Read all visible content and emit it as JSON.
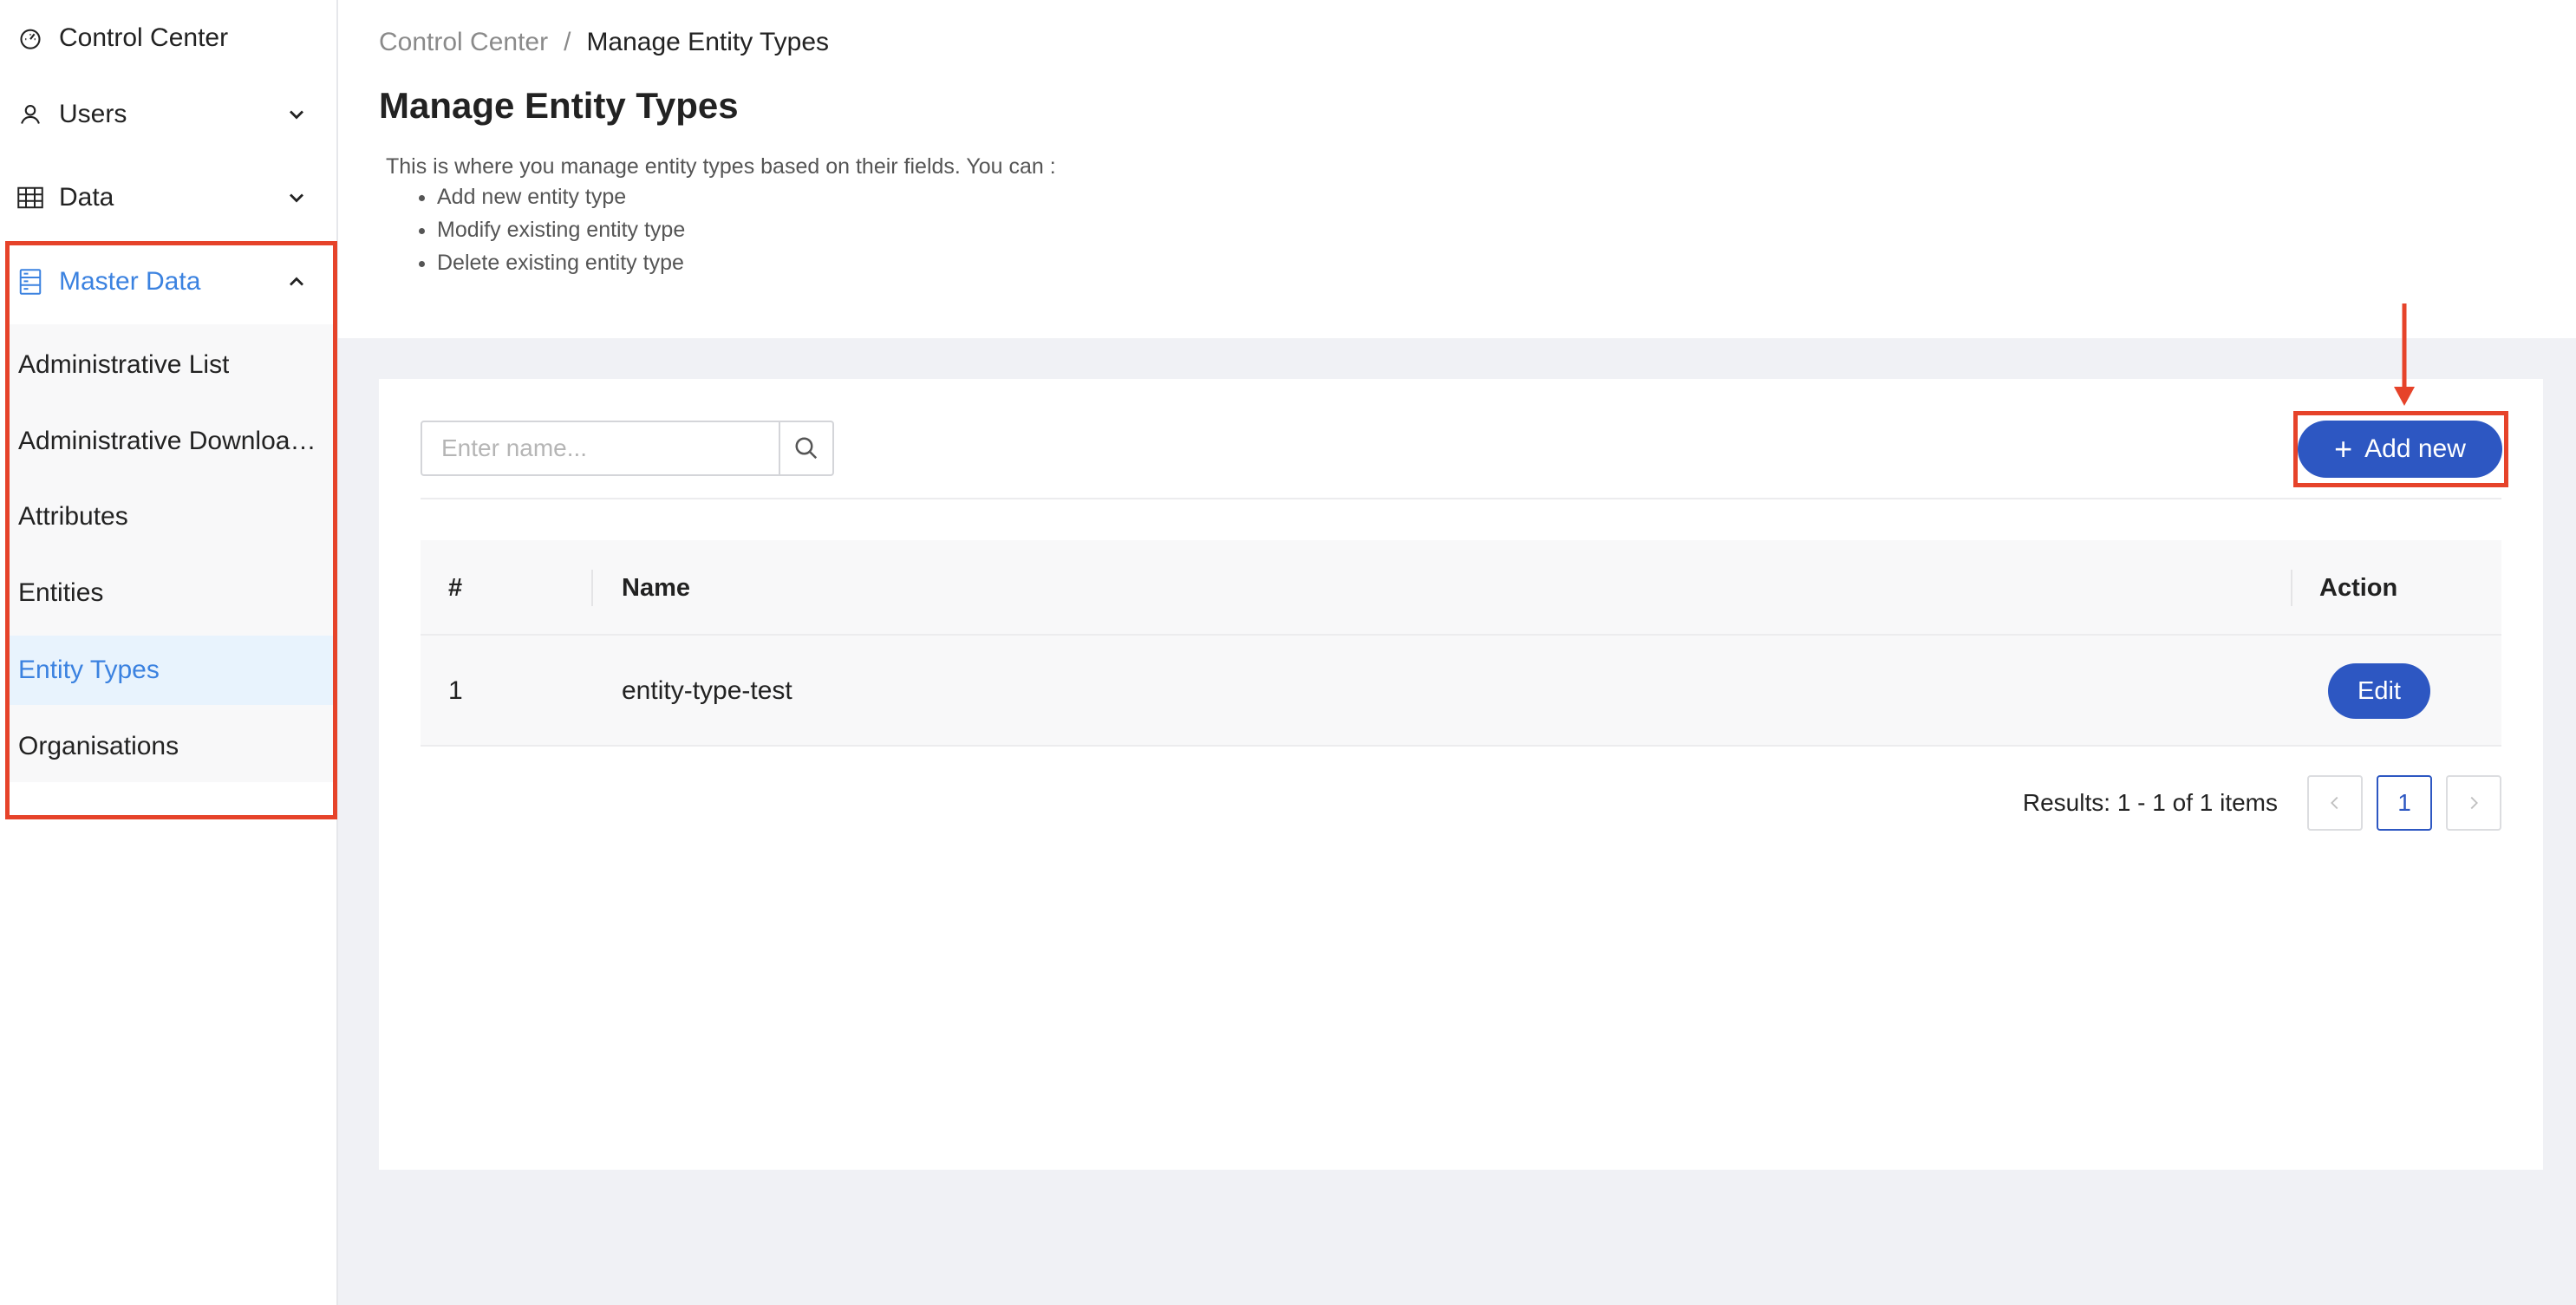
{
  "sidebar": {
    "items": [
      {
        "label": "Control Center",
        "icon": "dashboard-icon"
      },
      {
        "label": "Users",
        "icon": "user-icon",
        "expandable": true
      },
      {
        "label": "Data",
        "icon": "table-icon",
        "expandable": true
      },
      {
        "label": "Master Data",
        "icon": "database-icon",
        "expanded": true
      }
    ],
    "sub_items": [
      {
        "label": "Administrative List"
      },
      {
        "label": "Administrative Downloads"
      },
      {
        "label": "Attributes"
      },
      {
        "label": "Entities"
      },
      {
        "label": "Entity Types",
        "selected": true
      },
      {
        "label": "Organisations"
      }
    ]
  },
  "breadcrumb": {
    "root": "Control Center",
    "separator": "/",
    "current": "Manage Entity Types"
  },
  "page": {
    "title": "Manage Entity Types",
    "description": "This is where you manage entity types based on their fields. You can :",
    "bullets": [
      "Add new entity type",
      "Modify existing entity type",
      "Delete existing entity type"
    ]
  },
  "search": {
    "placeholder": "Enter name...",
    "value": ""
  },
  "toolbar": {
    "add_label": "Add new"
  },
  "table": {
    "columns": [
      "#",
      "Name",
      "Action"
    ],
    "rows": [
      {
        "index": "1",
        "name": "entity-type-test",
        "action": "Edit"
      }
    ]
  },
  "pagination": {
    "results": "Results: 1 - 1 of 1 items",
    "prev": "<",
    "current_page": "1",
    "next": ">"
  },
  "colors": {
    "accent": "#2d57c2",
    "active_link": "#3b82e0",
    "highlight": "#e6432a"
  }
}
